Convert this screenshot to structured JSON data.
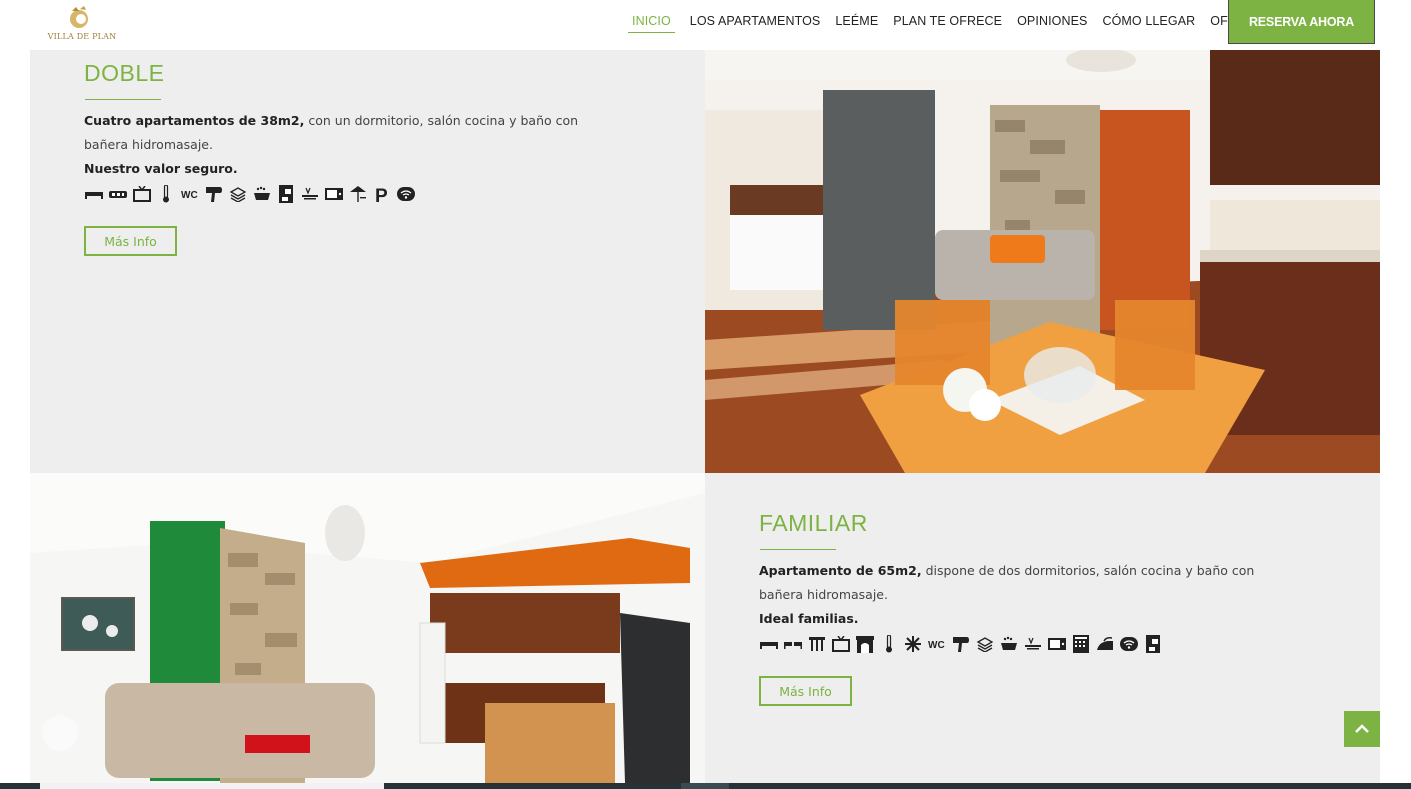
{
  "header": {
    "logo_text": "VILLA DE PLAN",
    "nav": [
      {
        "label": "INICIO",
        "active": true
      },
      {
        "label": "LOS APARTAMENTOS",
        "active": false
      },
      {
        "label": "LEÉME",
        "active": false
      },
      {
        "label": "PLAN TE OFRECE",
        "active": false
      },
      {
        "label": "OPINIONES",
        "active": false
      },
      {
        "label": "CÓMO LLEGAR",
        "active": false
      },
      {
        "label": "OFERTAS",
        "active": false
      }
    ],
    "cta_label": "RESERVA AHORA"
  },
  "colors": {
    "accent": "#7cb342",
    "panel_bg": "#eeeeee",
    "text": "#444444",
    "footer": "#263238"
  },
  "apartments": [
    {
      "title": "DOBLE",
      "desc_bold": "Cuatro apartamentos de 38m2,",
      "desc_rest": "  con un dormitorio, salón cocina y baño con bañera hidromasaje.",
      "tag": "Nuestro valor seguro.",
      "amenity_icons": [
        "single-bed-icon",
        "sofa-bed-icon",
        "tv-icon",
        "thermometer-icon",
        "wc-icon",
        "hair-dryer-icon",
        "towels-icon",
        "bathtub-icon",
        "coffee-maker-icon",
        "kitchen-hob-icon",
        "microwave-icon",
        "terrace-umbrella-icon",
        "parking-icon",
        "wifi-icon"
      ],
      "wc_label": "WC",
      "parking_label": "P",
      "button_label": "Más Info"
    },
    {
      "title": "FAMILIAR",
      "desc_bold": "Apartamento de 65m2,",
      "desc_rest": "  dispone de dos dormitorios, salón cocina y baño con bañera hidromasaje.",
      "tag": "Ideal familias.",
      "amenity_icons": [
        "single-bed-icon",
        "twin-beds-icon",
        "radiator-icon",
        "tv-icon",
        "fireplace-icon",
        "thermometer-icon",
        "snowflake-icon",
        "wc-icon",
        "hair-dryer-icon",
        "towels-icon",
        "bathtub-icon",
        "kitchen-hob-icon",
        "microwave-icon",
        "dishwasher-icon",
        "iron-icon",
        "wifi-icon",
        "coffee-maker-icon"
      ],
      "wc_label": "WC",
      "button_label": "Más Info"
    }
  ],
  "icons": {
    "scroll_top": "chevron-up-icon"
  }
}
